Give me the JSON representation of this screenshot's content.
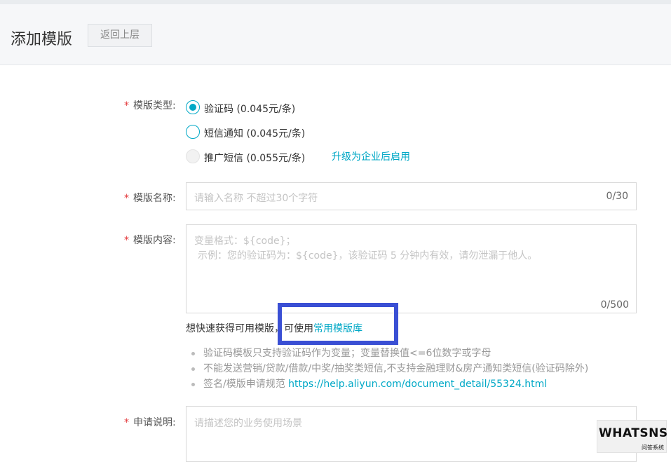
{
  "header": {
    "title": "添加模版",
    "back_label": "返回上层"
  },
  "form": {
    "type": {
      "label": "模版类型:",
      "options": [
        {
          "label": "验证码 (0.045元/条)",
          "state": "checked"
        },
        {
          "label": "短信通知 (0.045元/条)",
          "state": "unchecked"
        },
        {
          "label": "推广短信 (0.055元/条)",
          "state": "disabled"
        }
      ],
      "upgrade_link": "升级为企业后启用"
    },
    "name": {
      "label": "模版名称:",
      "placeholder": "请输入名称 不超过30个字符",
      "counter": "0/30"
    },
    "content": {
      "label": "模版内容:",
      "placeholder_line1": "变量格式：${code}；",
      "placeholder_line2": "示例：您的验证码为：${code}，该验证码 5 分钟内有效，请勿泄漏于他人。",
      "counter": "0/500",
      "quick_text": "想快速获得可用模版，可使用",
      "quick_link": "常用模版库",
      "tips": [
        "验证码模板只支持验证码作为变量；变量替换值<=6位数字或字母",
        "不能发送营销/贷款/借款/中奖/抽奖类短信,不支持金融理财&房产通知类短信(验证码除外)"
      ],
      "spec_text": "签名/模版申请规范 ",
      "spec_link": "https://help.aliyun.com/document_detail/55324.html"
    },
    "desc": {
      "label": "申请说明:",
      "placeholder": "请描述您的业务使用场景"
    }
  },
  "watermark": {
    "main": "WHATSNS",
    "sub": "问答系统"
  },
  "colors": {
    "accent": "#00a8c6",
    "required": "#e4393c",
    "highlight": "#3a4fd4"
  }
}
